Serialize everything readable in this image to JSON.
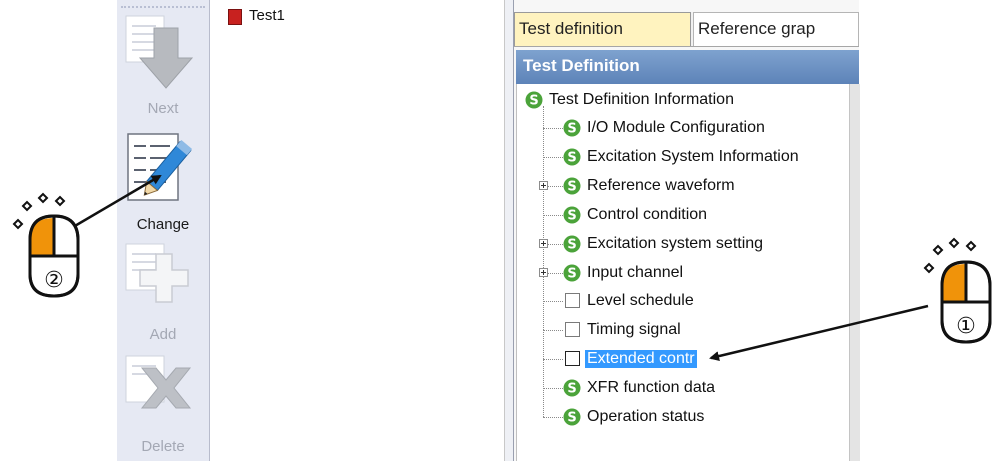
{
  "toolbar": {
    "next_label": "Next",
    "change_label": "Change",
    "add_label": "Add",
    "delete_label": "Delete"
  },
  "test_list": {
    "items": [
      {
        "label": "Test1",
        "color": "#c8211f"
      }
    ]
  },
  "tabs": {
    "active": "Test definition",
    "inactive": "Reference grap"
  },
  "section_header": "Test Definition",
  "tree": {
    "root": "Test Definition Information",
    "children": [
      {
        "label": "I/O Module Configuration",
        "icon": "s-icon"
      },
      {
        "label": "Excitation System Information",
        "icon": "s-icon"
      },
      {
        "label": "Reference waveform",
        "icon": "s-icon",
        "expandable": true
      },
      {
        "label": "Control condition",
        "icon": "s-icon"
      },
      {
        "label": "Excitation system setting",
        "icon": "s-icon",
        "expandable": true
      },
      {
        "label": "Input channel",
        "icon": "s-icon",
        "expandable": true
      },
      {
        "label": "Level schedule",
        "icon": "checkbox"
      },
      {
        "label": "Timing signal",
        "icon": "checkbox"
      },
      {
        "label": "Extended contr",
        "icon": "checkbox",
        "selected": true
      },
      {
        "label": "XFR function data",
        "icon": "s-icon"
      },
      {
        "label": "Operation status",
        "icon": "s-icon"
      }
    ]
  },
  "annotations": {
    "step_1": "①",
    "step_2": "②"
  },
  "colors": {
    "s_icon_green": "#4ba33a",
    "selection_blue": "#3399ff",
    "header_blue": "#6a8fc4",
    "mouse_button_orange": "#f0930a",
    "active_tab": "#fff3bf"
  }
}
